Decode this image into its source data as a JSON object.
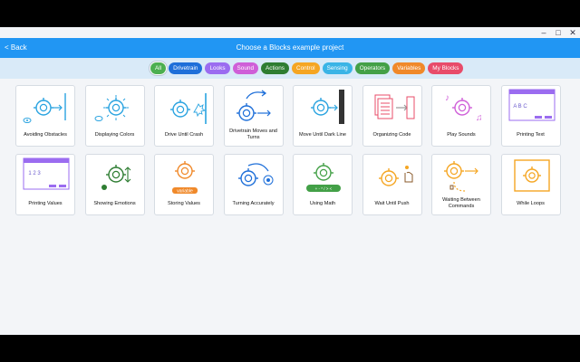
{
  "window": {
    "controls": [
      "–",
      "□",
      "✕"
    ]
  },
  "header": {
    "back_label": "< Back",
    "title": "Choose a Blocks example project"
  },
  "tabs": [
    {
      "label": "All",
      "color": "#4caf50",
      "active": true
    },
    {
      "label": "Drivetrain",
      "color": "#1e6fd9"
    },
    {
      "label": "Looks",
      "color": "#9b6cf0"
    },
    {
      "label": "Sound",
      "color": "#cf5fd8"
    },
    {
      "label": "Actions",
      "color": "#2e7d32"
    },
    {
      "label": "Control",
      "color": "#f5a623"
    },
    {
      "label": "Sensing",
      "color": "#3ab4e6"
    },
    {
      "label": "Operators",
      "color": "#43a047"
    },
    {
      "label": "Variables",
      "color": "#f0892a"
    },
    {
      "label": "My Blocks",
      "color": "#e84c6a"
    }
  ],
  "examples": [
    {
      "label": "Avoiding Obstacles",
      "icon": "robot-wall-obstacle-icon",
      "color": "#29a3e0"
    },
    {
      "label": "Displaying Colors",
      "icon": "robot-color-burst-icon",
      "color": "#29a3e0"
    },
    {
      "label": "Drive Until Crash",
      "icon": "robot-crash-icon",
      "color": "#29a3e0"
    },
    {
      "label": "Drivetrain Moves and Turns",
      "icon": "robot-turn-arrow-icon",
      "color": "#1e6fd9"
    },
    {
      "label": "Move Until Dark Line",
      "icon": "robot-dark-line-icon",
      "color": "#29a3e0"
    },
    {
      "label": "Organizing Code",
      "icon": "code-pages-icon",
      "color": "#e84c6a"
    },
    {
      "label": "Play Sounds",
      "icon": "robot-music-notes-icon",
      "color": "#cf5fd8"
    },
    {
      "label": "Printing Text",
      "icon": "print-text-window-icon",
      "color": "#9b6cf0"
    },
    {
      "label": "Printing Values",
      "icon": "print-values-window-icon",
      "color": "#9b6cf0"
    },
    {
      "label": "Showing Emotions",
      "icon": "robot-emotion-icon",
      "color": "#2e7d32"
    },
    {
      "label": "Storing Values",
      "icon": "robot-variable-icon",
      "color": "#f0892a"
    },
    {
      "label": "Turning Accurately",
      "icon": "robot-precise-turn-icon",
      "color": "#1e6fd9"
    },
    {
      "label": "Using Math",
      "icon": "robot-math-operators-icon",
      "color": "#43a047"
    },
    {
      "label": "Wait Until Push",
      "icon": "robot-push-hand-icon",
      "color": "#f5a623"
    },
    {
      "label": "Waiting Between Commands",
      "icon": "robot-wait-path-icon",
      "color": "#f5a623"
    },
    {
      "label": "While Loops",
      "icon": "robot-loop-box-icon",
      "color": "#f5a623"
    }
  ],
  "icon_text": {
    "printing_text": "A B C",
    "printing_values": "1 2 3",
    "math_ops": "+ - * / > <",
    "variable": "variable"
  }
}
